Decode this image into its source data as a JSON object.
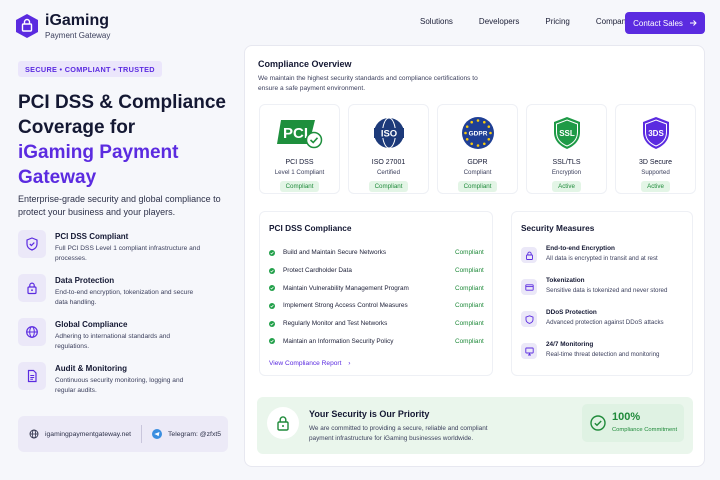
{
  "brand": {
    "name": "iGaming",
    "subtitle": "Payment Gateway"
  },
  "nav": {
    "items": [
      "Solutions",
      "Developers",
      "Pricing",
      "Company"
    ],
    "cta": "Contact Sales"
  },
  "hero": {
    "pill": "SECURE • COMPLIANT • TRUSTED",
    "title_line1": "PCI DSS & Compliance",
    "title_line2": "Coverage for",
    "title_accent": "iGaming Payment Gateway",
    "description": "Enterprise-grade security and global compliance to protect your business and your players."
  },
  "features": [
    {
      "icon": "shield-check-icon",
      "title": "PCI DSS Compliant",
      "desc": "Full PCI DSS Level 1 compliant infrastructure and processes."
    },
    {
      "icon": "lock-icon",
      "title": "Data Protection",
      "desc": "End-to-end encryption, tokenization and secure data handling."
    },
    {
      "icon": "globe-icon",
      "title": "Global Compliance",
      "desc": "Adhering to international standards and regulations."
    },
    {
      "icon": "document-icon",
      "title": "Audit & Monitoring",
      "desc": "Continuous security monitoring, logging and regular audits."
    }
  ],
  "contact": {
    "website": "igamingpaymentgateway.net",
    "telegram": "Telegram: @zfxt5"
  },
  "overview": {
    "title": "Compliance Overview",
    "description": "We maintain the highest security standards and compliance certifications to ensure a safe payment environment."
  },
  "certs": [
    {
      "icon": "pci-logo-icon",
      "name": "PCI DSS",
      "sub": "Level 1 Compliant",
      "badge": "Compliant"
    },
    {
      "icon": "iso-logo-icon",
      "name": "ISO 27001",
      "sub": "Certified",
      "badge": "Compliant"
    },
    {
      "icon": "gdpr-logo-icon",
      "name": "GDPR",
      "sub": "Compliant",
      "badge": "Compliant"
    },
    {
      "icon": "ssl-shield-icon",
      "name": "SSL/TLS",
      "sub": "Encryption",
      "badge": "Active"
    },
    {
      "icon": "3ds-shield-icon",
      "name": "3D Secure",
      "sub": "Supported",
      "badge": "Active"
    }
  ],
  "pci_section": {
    "title": "PCI DSS Compliance",
    "rows": [
      {
        "label": "Build and Maintain Secure Networks",
        "status": "Compliant"
      },
      {
        "label": "Protect Cardholder Data",
        "status": "Compliant"
      },
      {
        "label": "Maintain Vulnerability Management Program",
        "status": "Compliant"
      },
      {
        "label": "Implement Strong Access Control Measures",
        "status": "Compliant"
      },
      {
        "label": "Regularly Monitor and Test Networks",
        "status": "Compliant"
      },
      {
        "label": "Maintain an Information Security Policy",
        "status": "Compliant"
      }
    ],
    "link": "View Compliance Report"
  },
  "security": {
    "title": "Security Measures",
    "items": [
      {
        "icon": "lock-icon",
        "name": "End-to-end Encryption",
        "desc": "All data is encrypted in transit and at rest"
      },
      {
        "icon": "card-icon",
        "name": "Tokenization",
        "desc": "Sensitive data is tokenized and never stored"
      },
      {
        "icon": "shield-icon",
        "name": "DDoS Protection",
        "desc": "Advanced protection against DDoS attacks"
      },
      {
        "icon": "monitor-icon",
        "name": "24/7 Monitoring",
        "desc": "Real-time threat detection and monitoring"
      }
    ]
  },
  "priority": {
    "title": "Your Security is Our Priority",
    "desc": "We are committed to providing a secure, reliable and compliant payment infrastructure for iGaming businesses worldwide.",
    "stat": "100%",
    "stat_label": "Compliance Commitment"
  },
  "colors": {
    "accent": "#5b2be0",
    "success": "#1f8a3a",
    "success_bg": "#e3f5e6"
  }
}
